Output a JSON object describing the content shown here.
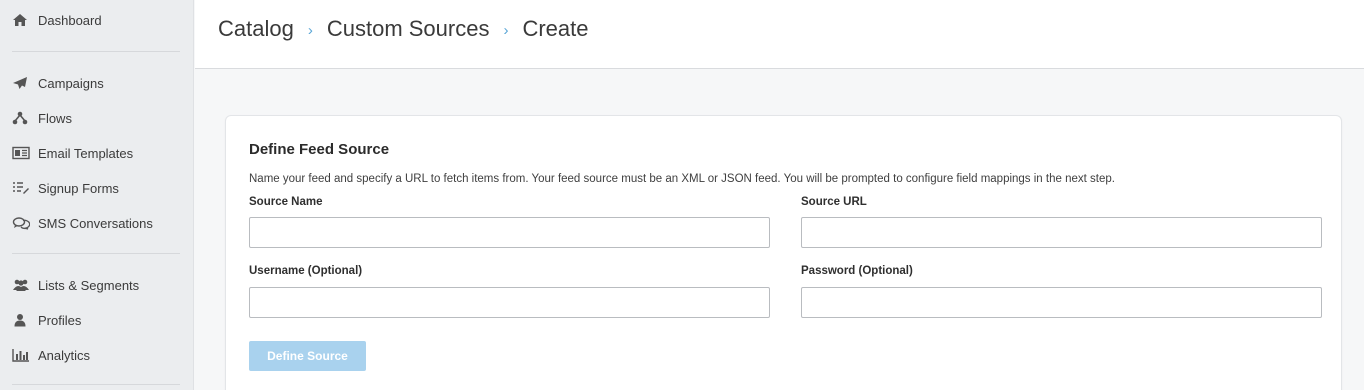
{
  "sidebar": {
    "items": [
      {
        "label": "Dashboard",
        "icon": "home-icon"
      },
      {
        "label": "Campaigns",
        "icon": "paper-plane-icon"
      },
      {
        "label": "Flows",
        "icon": "flow-icon"
      },
      {
        "label": "Email Templates",
        "icon": "template-icon"
      },
      {
        "label": "Signup Forms",
        "icon": "form-list-icon"
      },
      {
        "label": "SMS Conversations",
        "icon": "chat-bubbles-icon"
      },
      {
        "label": "Lists & Segments",
        "icon": "users-icon"
      },
      {
        "label": "Profiles",
        "icon": "user-icon"
      },
      {
        "label": "Analytics",
        "icon": "bar-chart-icon"
      }
    ]
  },
  "header": {
    "breadcrumb": [
      "Catalog",
      "Custom Sources",
      "Create"
    ],
    "separator": "›"
  },
  "form": {
    "title": "Define Feed Source",
    "description": "Name your feed and specify a URL to fetch items from. Your feed source must be an XML or JSON feed. You will be prompted to configure field mappings in the next step.",
    "fields": {
      "source_name": {
        "label": "Source Name",
        "value": ""
      },
      "source_url": {
        "label": "Source URL",
        "value": ""
      },
      "username": {
        "label": "Username (Optional)",
        "value": ""
      },
      "password": {
        "label": "Password (Optional)",
        "value": ""
      }
    },
    "submit_label": "Define Source"
  },
  "colors": {
    "accent": "#5aa6d6",
    "button_disabled": "#a9d2ee",
    "sidebar_bg": "#ebedef"
  }
}
